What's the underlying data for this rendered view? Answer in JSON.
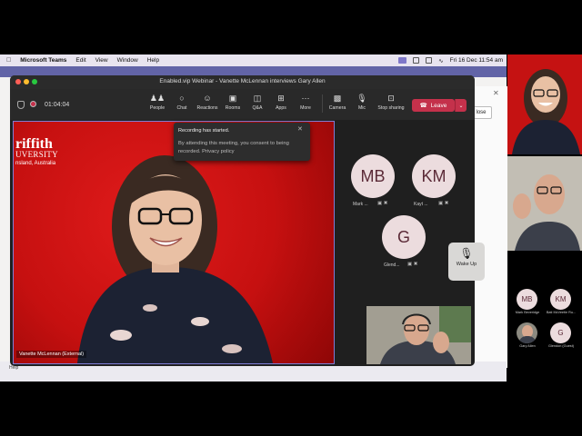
{
  "menubar": {
    "app_name": "Microsoft Teams",
    "items": [
      "Edit",
      "View",
      "Window",
      "Help"
    ],
    "clock": "Fri 16 Dec  11:54 am"
  },
  "window": {
    "title": "Enabled.vip Webinar - Vanette McLennan interviews Gary Allen"
  },
  "toolbar": {
    "timer": "01:04:04",
    "buttons": [
      {
        "label": "People",
        "icon": "people-icon"
      },
      {
        "label": "Chat",
        "icon": "chat-icon"
      },
      {
        "label": "Reactions",
        "icon": "reactions-icon"
      },
      {
        "label": "Rooms",
        "icon": "rooms-icon"
      },
      {
        "label": "Q&A",
        "icon": "qa-icon"
      },
      {
        "label": "Apps",
        "icon": "apps-icon"
      },
      {
        "label": "More",
        "icon": "more-icon"
      },
      {
        "label": "Camera",
        "icon": "camera-icon"
      },
      {
        "label": "Mic",
        "icon": "mic-icon"
      },
      {
        "label": "Stop sharing",
        "icon": "stop-sharing-icon"
      }
    ],
    "leave_label": "Leave"
  },
  "main_video": {
    "logo_line1": "riffith",
    "logo_line2": "UVERSITY",
    "logo_line3": "nsland, Australia",
    "name_tag": "Vanette McLennan (External)"
  },
  "notification": {
    "title": "Recording has started.",
    "body": "By attending this meeting, you consent to being recorded. Privacy policy"
  },
  "participants": [
    {
      "initials": "MB",
      "label": "Mark ..."
    },
    {
      "initials": "KM",
      "label": "Kayt ..."
    },
    {
      "initials": "G",
      "label": "Glend..."
    }
  ],
  "wake_up": "Wake Up",
  "background_app": {
    "close_label": "lose",
    "help_label": "Help"
  },
  "side_panel": {
    "avatars": [
      {
        "initials": "MB",
        "label": "Mark Beveridge"
      },
      {
        "initials": "KM",
        "label": "Bati McVeetie Ru..."
      },
      {
        "initials": "",
        "label": "Gary Allen"
      },
      {
        "initials": "G",
        "label": "Glendon (Guest)"
      }
    ]
  }
}
